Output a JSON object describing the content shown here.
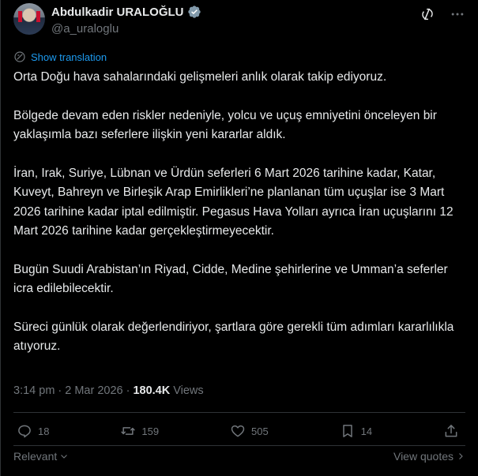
{
  "author": {
    "display_name": "Abdulkadir URALOĞLU",
    "handle": "@a_uraloglu",
    "avatar_icon": "profile-photo",
    "verified_icon": "verified-badge-icon"
  },
  "header_icons": [
    "grok-icon",
    "more-icon"
  ],
  "translate": {
    "label": "Show translation",
    "icon": "translate-icon"
  },
  "body": {
    "paragraphs": [
      "Orta Doğu hava sahalarındaki gelişmeleri anlık olarak takip ediyoruz.",
      "Bölgede devam eden riskler nedeniyle, yolcu ve uçuş emniyetini önceleyen bir yaklaşımla bazı seferlere ilişkin yeni kararlar aldık.",
      "İran, Irak, Suriye, Lübnan ve Ürdün seferleri 6 Mart 2026 tarihine kadar, Katar, Kuveyt, Bahreyn ve Birleşik Arap Emirlikleri’ne planlanan tüm uçuşlar ise 3 Mart 2026 tarihine kadar iptal edilmiştir. Pegasus Hava Yolları ayrıca İran uçuşlarını 12 Mart 2026 tarihine kadar gerçekleştirmeyecektir.",
      "Bugün Suudi Arabistan’ın Riyad, Cidde, Medine şehirlerine ve Umman’a seferler icra edilebilecektir.",
      "Süreci günlük olarak değerlendiriyor, şartlara göre gerekli tüm adımları kararlılıkla atıyoruz."
    ]
  },
  "meta": {
    "time": "3:14 pm",
    "separator": "·",
    "date": "2 Mar 2026",
    "views_count": "180.4K",
    "views_label": "Views"
  },
  "actions": {
    "replies": "18",
    "reposts": "159",
    "likes": "505",
    "bookmarks": "14"
  },
  "footer": {
    "sort_label": "Relevant",
    "quotes_label": "View quotes"
  },
  "colors": {
    "background": "#000000",
    "text": "#e7e9ea",
    "muted": "#71767b",
    "accent": "#1d9bf0",
    "divider": "#2f3336"
  }
}
